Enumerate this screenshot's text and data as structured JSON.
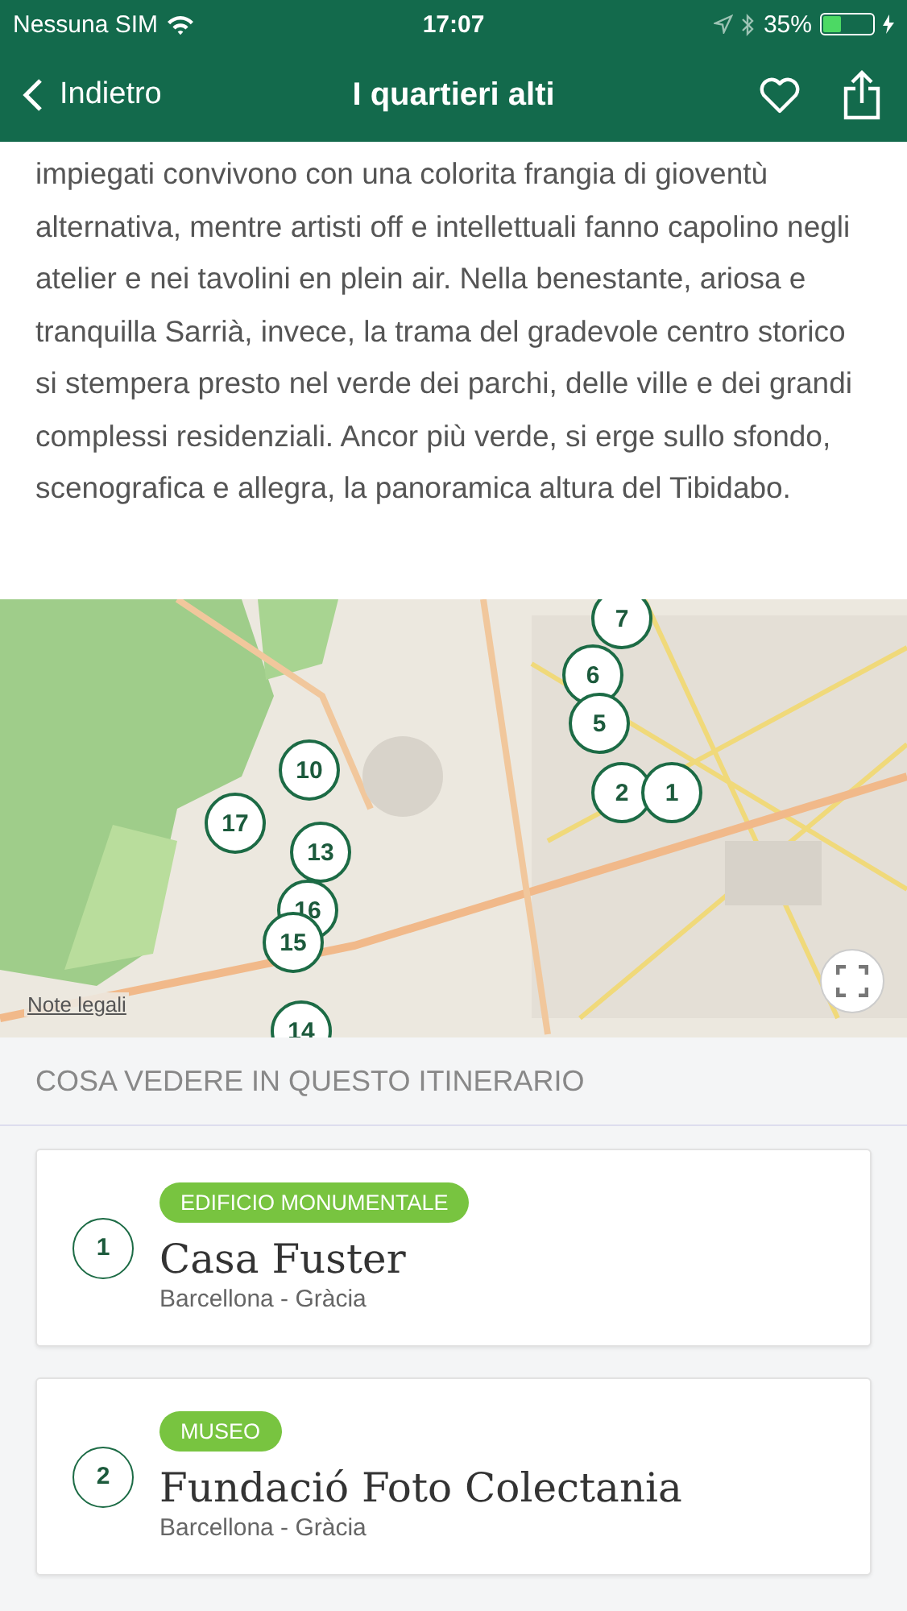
{
  "status_bar": {
    "carrier": "Nessuna SIM",
    "time": "17:07",
    "battery": "35%",
    "level": 0.35
  },
  "nav": {
    "back": "Indietro",
    "title": "I quartieri alti"
  },
  "intro": "impiegati convivono con una colorita frangia di gioventù alternativa, mentre artisti off e intellettuali fanno capolino negli atelier e nei tavolini en plein air. Nella benestante, ariosa e tranquilla Sarrià, invece, la trama del gradevole centro storico si stempera presto nel verde dei parchi, delle ville e dei grandi complessi residenziali. Ancor più verde, si erge sullo sfondo, scenografica e allegra, la panoramica altura del Tibidabo.",
  "map": {
    "legal_link": "Note legali",
    "pins": [
      {
        "label": "7"
      },
      {
        "label": "6"
      },
      {
        "label": "5"
      },
      {
        "label": "2"
      },
      {
        "label": "1"
      },
      {
        "label": "10"
      },
      {
        "label": "17"
      },
      {
        "label": "13"
      },
      {
        "label": "16"
      },
      {
        "label": "15"
      },
      {
        "label": "14"
      }
    ]
  },
  "section_title": "COSA VEDERE IN QUESTO ITINERARIO",
  "places": [
    {
      "number": "1",
      "category": "EDIFICIO MONUMENTALE",
      "name": "Casa Fuster",
      "location": "Barcellona - Gràcia"
    },
    {
      "number": "2",
      "category": "MUSEO",
      "name": "Fundació Foto Colectania",
      "location": "Barcellona - Gràcia"
    }
  ]
}
